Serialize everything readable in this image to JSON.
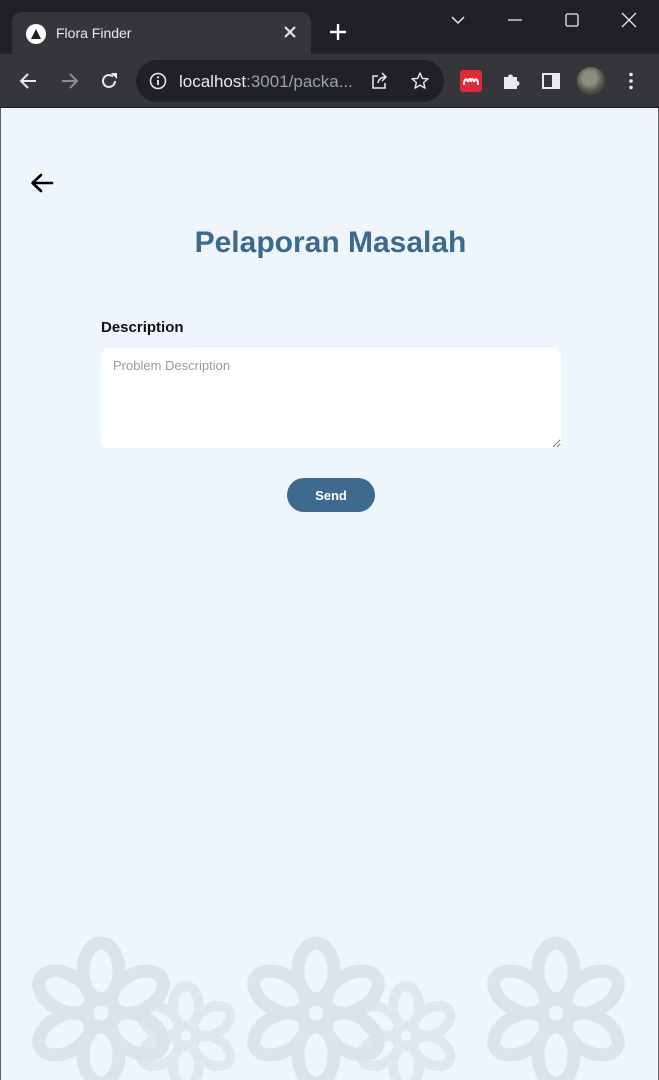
{
  "browser": {
    "tab_title": "Flora Finder",
    "url_host": "localhost",
    "url_rest": ":3001/packa...",
    "ext_color": "#e02a3c"
  },
  "page": {
    "title": "Pelaporan Masalah",
    "description_label": "Description",
    "description_placeholder": "Problem Description",
    "description_value": "",
    "send_label": "Send",
    "accent_color": "#3d6a8e",
    "background_color": "#eff5fd"
  },
  "icons": {
    "back": "arrow-left-icon",
    "decor": "flower-pattern"
  }
}
